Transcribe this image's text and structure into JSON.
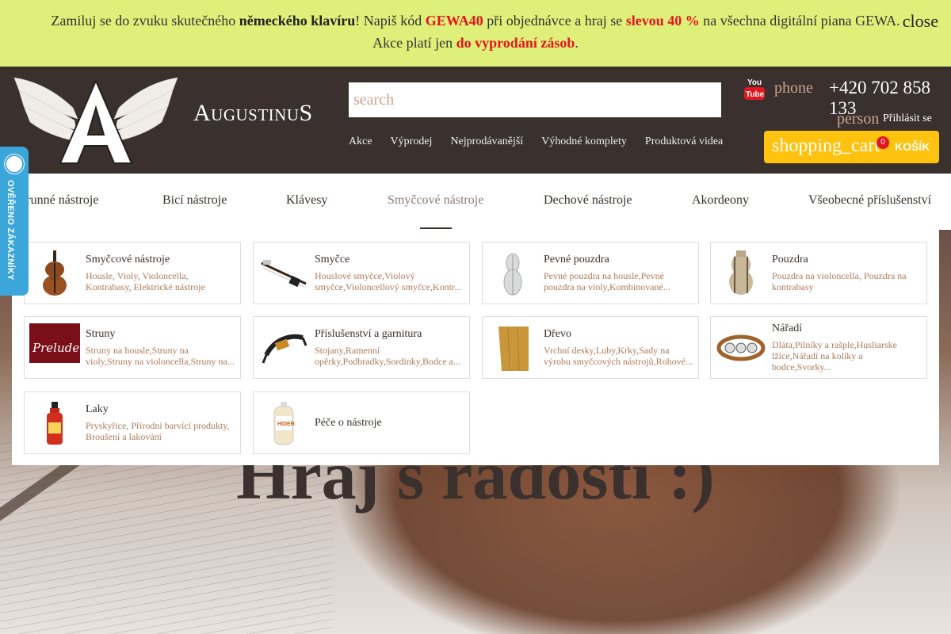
{
  "promo": {
    "line1_a": "Zamiluj se do zvuku skutečného ",
    "line1_b": "německého klavíru",
    "line1_c": "! Napiš kód ",
    "code": "GEWA40",
    "line1_d": " při objednávce a hraj se ",
    "discount": "slevou 40 %",
    "line1_e": " na všechna digitální piana GEWA.",
    "line2_a": "Akce platí jen ",
    "line2_b": "do vyprodání zásob",
    "line2_c": ".",
    "close_label": "close"
  },
  "header": {
    "logo_text": "AugustinuS",
    "search_placeholder": "search",
    "nav": [
      "Akce",
      "Výprodej",
      "Nejprodávanější",
      "Výhodné komplety",
      "Produktová videa"
    ],
    "phone_icon": "phone",
    "phone_number": "+420 702 858 133",
    "person_icon": "person",
    "login_label": "Přihlásit se",
    "cart_icon": "shopping_cart",
    "cart_count": "0",
    "cart_label": "KOŠÍK"
  },
  "mainnav": {
    "items": [
      "Strunné nástroje",
      "Bicí nástroje",
      "Klávesy",
      "Smyčcové nástroje",
      "Dechové nástroje",
      "Akordeony",
      "Všeobecné příslušenství"
    ],
    "active_index": 3
  },
  "dropdown": {
    "cards": [
      {
        "title": "Smyčcové nástroje",
        "sub": "Housle, Violy, Violoncella, Kontrabasy, Elektrické nástroje"
      },
      {
        "title": "Smyčce",
        "sub": "Houslové smyčce,Violový smyčce,Violoncellový smyčce,Kontr..."
      },
      {
        "title": "Pevné pouzdra",
        "sub": "Pevné pouzdra na housle,Pevné pouzdra na violy,Kombinované..."
      },
      {
        "title": "Pouzdra",
        "sub": "Pouzdra na violoncella, Pouzdra na kontrabasy"
      },
      {
        "title": "Struny",
        "sub": "Struny na housle,Struny na violy,Struny na violoncella,Struny na..."
      },
      {
        "title": "Příslušenství a garnitura",
        "sub": "Stojany,Ramenní opěrky,Podbradky,Sordinky,Bodce a..."
      },
      {
        "title": "Dřevo",
        "sub": "Vrchní desky,Luby,Krky,Sady na výrobu smyčcových nástrojů,Rohové..."
      },
      {
        "title": "Nářadí",
        "sub": "Dláta,Pilníky a rašple,Husliarske lžíce,Nářadí na kolíky a bodce,Svorky..."
      },
      {
        "title": "Laky",
        "sub": "Pryskyřice, Přírodní barvící produkty, Broušení a lakování"
      },
      {
        "title": "Péče o nástroje",
        "sub": ""
      }
    ],
    "thumb_labels": {
      "strings_brand": "Prelude",
      "care_brand": "HIDER"
    }
  },
  "hero": {
    "title": "Hraj s radostí :)"
  },
  "verified": {
    "label": "OVĚŘENO ZÁKAZNÍKY"
  },
  "colors": {
    "promo_bg": "#dff07a",
    "header_bg": "#3a302d",
    "accent_red": "#e3151f",
    "cart_yellow": "#ffc20e",
    "link_brown": "#b07a58",
    "verified_blue": "#3ba6d9"
  }
}
